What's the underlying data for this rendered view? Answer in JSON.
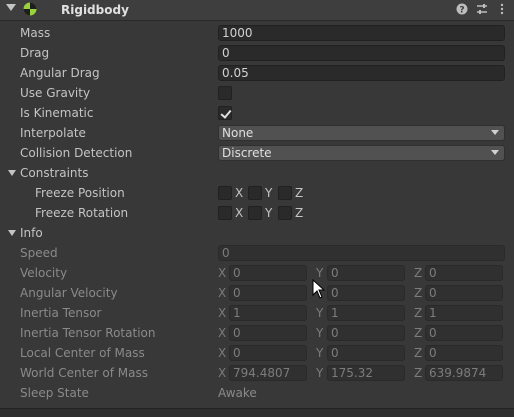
{
  "component": {
    "title": "Rigidbody",
    "icons": [
      "help-icon",
      "presets-icon",
      "more-icon"
    ]
  },
  "props": {
    "mass": {
      "label": "Mass",
      "value": "1000"
    },
    "drag": {
      "label": "Drag",
      "value": "0"
    },
    "angular_drag": {
      "label": "Angular Drag",
      "value": "0.05"
    },
    "use_gravity": {
      "label": "Use Gravity",
      "checked": false
    },
    "is_kinematic": {
      "label": "Is Kinematic",
      "checked": true
    },
    "interpolate": {
      "label": "Interpolate",
      "value": "None"
    },
    "collision_detection": {
      "label": "Collision Detection",
      "value": "Discrete"
    }
  },
  "constraints": {
    "label": "Constraints",
    "freeze_position": {
      "label": "Freeze Position",
      "x": "X",
      "y": "Y",
      "z": "Z"
    },
    "freeze_rotation": {
      "label": "Freeze Rotation",
      "x": "X",
      "y": "Y",
      "z": "Z"
    }
  },
  "info": {
    "label": "Info",
    "speed": {
      "label": "Speed",
      "value": "0"
    },
    "velocity": {
      "label": "Velocity",
      "x": "0",
      "y": "0",
      "z": "0"
    },
    "angular_velocity": {
      "label": "Angular Velocity",
      "x": "0",
      "y": "0",
      "z": "0"
    },
    "inertia_tensor": {
      "label": "Inertia Tensor",
      "x": "1",
      "y": "1",
      "z": "1"
    },
    "inertia_tensor_rotation": {
      "label": "Inertia Tensor Rotation",
      "x": "0",
      "y": "0",
      "z": "0"
    },
    "local_center_of_mass": {
      "label": "Local Center of Mass",
      "x": "0",
      "y": "0",
      "z": "0"
    },
    "world_center_of_mass": {
      "label": "World Center of Mass",
      "x": "794.4807",
      "y": "175.32",
      "z": "639.9874"
    },
    "sleep_state": {
      "label": "Sleep State",
      "value": "Awake"
    }
  },
  "axis_labels": {
    "x": "X",
    "y": "Y",
    "z": "Z"
  }
}
